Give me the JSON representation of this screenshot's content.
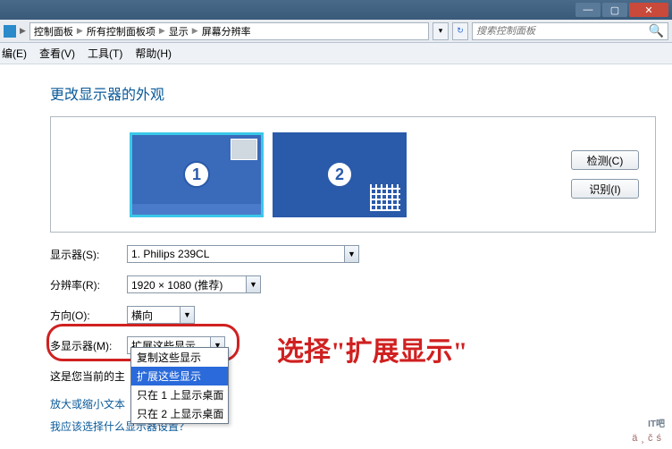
{
  "titlebar": {
    "min": "—",
    "max": "▢",
    "close": "✕"
  },
  "breadcrumb": {
    "items": [
      "控制面板",
      "所有控制面板项",
      "显示",
      "屏幕分辨率"
    ],
    "sep": "▶"
  },
  "search": {
    "placeholder": "搜索控制面板"
  },
  "menu": {
    "edit": "编(E)",
    "view": "查看(V)",
    "tools": "工具(T)",
    "help": "帮助(H)"
  },
  "heading": "更改显示器的外观",
  "monitors": {
    "num1": "1",
    "num2": "2"
  },
  "buttons": {
    "detect": "检测(C)",
    "identify": "识别(I)"
  },
  "form": {
    "display_label": "显示器(S):",
    "display_value": "1. Philips 239CL",
    "resolution_label": "分辨率(R):",
    "resolution_value": "1920 × 1080 (推荐)",
    "orientation_label": "方向(O):",
    "orientation_value": "横向",
    "multi_label": "多显示器(M):",
    "multi_value": "扩展这些显示"
  },
  "dropdown": {
    "options": [
      "复制这些显示",
      "扩展这些显示",
      "只在 1 上显示桌面",
      "只在 2 上显示桌面"
    ],
    "selected_index": 1
  },
  "notice": "这是您当前的主",
  "link1": "放大或缩小文本",
  "link2": "我应该选择什么显示器设置？",
  "annotation": "选择\"扩展显示\"",
  "watermark": "ä¸čś",
  "brand": "IT吧"
}
